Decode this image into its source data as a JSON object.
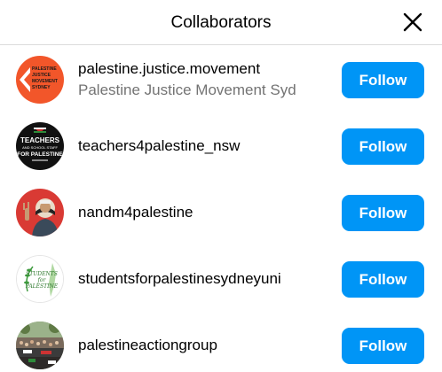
{
  "dialog": {
    "title": "Collaborators",
    "close_icon": "close-icon"
  },
  "collaborators": [
    {
      "username": "palestine.justice.movement",
      "full_name": "Palestine Justice Movement Syd",
      "avatar_text": [
        "PALESTINE",
        "JUSTICE",
        "MOVEMENT",
        "SYDNEY"
      ],
      "button_label": "Follow"
    },
    {
      "username": "teachers4palestine_nsw",
      "full_name": "",
      "avatar_text": [
        "TEACHERS",
        "AND SCHOOL STAFF",
        "FOR PALESTINE"
      ],
      "button_label": "Follow"
    },
    {
      "username": "nandm4palestine",
      "full_name": "",
      "avatar_text": [],
      "button_label": "Follow"
    },
    {
      "username": "studentsforpalestinesydneyuni",
      "full_name": "",
      "avatar_text": [
        "STUDENTS",
        "for",
        "PALESTINE"
      ],
      "button_label": "Follow"
    },
    {
      "username": "palestineactiongroup",
      "full_name": "",
      "avatar_text": [],
      "button_label": "Follow"
    }
  ],
  "colors": {
    "follow_button": "#0095f6",
    "secondary_text": "#737373",
    "divider": "#dbdbdb"
  }
}
